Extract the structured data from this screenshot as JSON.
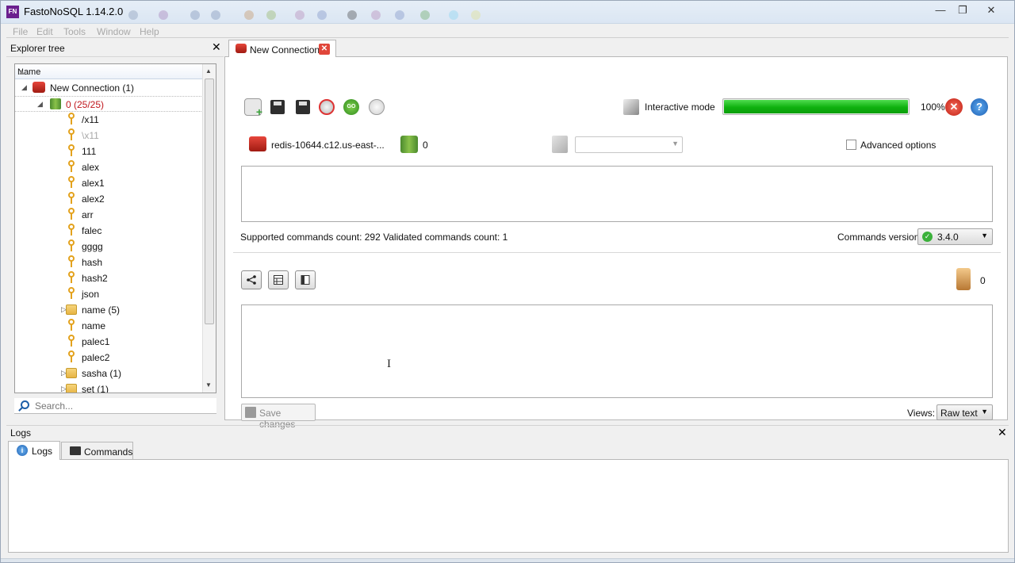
{
  "window": {
    "title": "FastoNoSQL 1.14.2.0",
    "icon_text": "FN",
    "minimize": "—",
    "maximize": "❐",
    "close": "✕"
  },
  "menu": [
    "File",
    "Edit",
    "Tools",
    "Window",
    "Help"
  ],
  "explorer": {
    "title": "Explorer tree",
    "column_header": "Name",
    "search_placeholder": "Search...",
    "items": [
      {
        "label": "New Connection (1)",
        "type": "connection",
        "level": 0,
        "expander": "◢"
      },
      {
        "label": "0 (25/25)",
        "type": "database",
        "level": 1,
        "expander": "◢"
      },
      {
        "label": "/x11",
        "type": "key",
        "level": 2
      },
      {
        "label": "\\x11",
        "type": "key",
        "level": 2,
        "muted": true
      },
      {
        "label": "111",
        "type": "key",
        "level": 2
      },
      {
        "label": "alex",
        "type": "key",
        "level": 2
      },
      {
        "label": "alex1",
        "type": "key",
        "level": 2
      },
      {
        "label": "alex2",
        "type": "key",
        "level": 2
      },
      {
        "label": "arr",
        "type": "key",
        "level": 2
      },
      {
        "label": "falec",
        "type": "key",
        "level": 2
      },
      {
        "label": "gggg",
        "type": "key",
        "level": 2
      },
      {
        "label": "hash",
        "type": "key",
        "level": 2
      },
      {
        "label": "hash2",
        "type": "key",
        "level": 2
      },
      {
        "label": "json",
        "type": "key",
        "level": 2
      },
      {
        "label": "name (5)",
        "type": "folder",
        "level": 2,
        "expander": "▷"
      },
      {
        "label": "name",
        "type": "key",
        "level": 2
      },
      {
        "label": "palec1",
        "type": "key",
        "level": 2
      },
      {
        "label": "palec2",
        "type": "key",
        "level": 2
      },
      {
        "label": "sasha (1)",
        "type": "folder",
        "level": 2,
        "expander": "▷"
      },
      {
        "label": "set (1)",
        "type": "folder",
        "level": 2,
        "expander": "▷"
      }
    ]
  },
  "tab": {
    "label": "New Connection",
    "close": "✕"
  },
  "toolbar": {
    "icons": [
      "open-file-icon",
      "save-icon",
      "save-as-icon",
      "stop-icon",
      "execute-icon",
      "hand-icon"
    ],
    "execute_text": "GO",
    "interactive_label": "Interactive mode",
    "progress_value": 1.0,
    "progress_text": "100%",
    "close_glyph": "✕",
    "help_glyph": "?"
  },
  "connection": {
    "server": "redis-10644.c12.us-east-...",
    "db_count": "0",
    "advanced_label": "Advanced options"
  },
  "status": {
    "counts": "Supported commands count: 292  Validated commands count: 1",
    "version_label": "Commands version:",
    "version_value": "3.4.0"
  },
  "output": {
    "hourglass_count": "0",
    "save_label": "Save changes",
    "views_label": "Views:",
    "views_value": "Raw text"
  },
  "logs": {
    "title": "Logs",
    "tabs": [
      "Logs",
      "Commands"
    ]
  },
  "colors": {
    "accent_green": "#0fb10f",
    "redis_red": "#c0171d",
    "key_orange": "#e3a21d"
  }
}
